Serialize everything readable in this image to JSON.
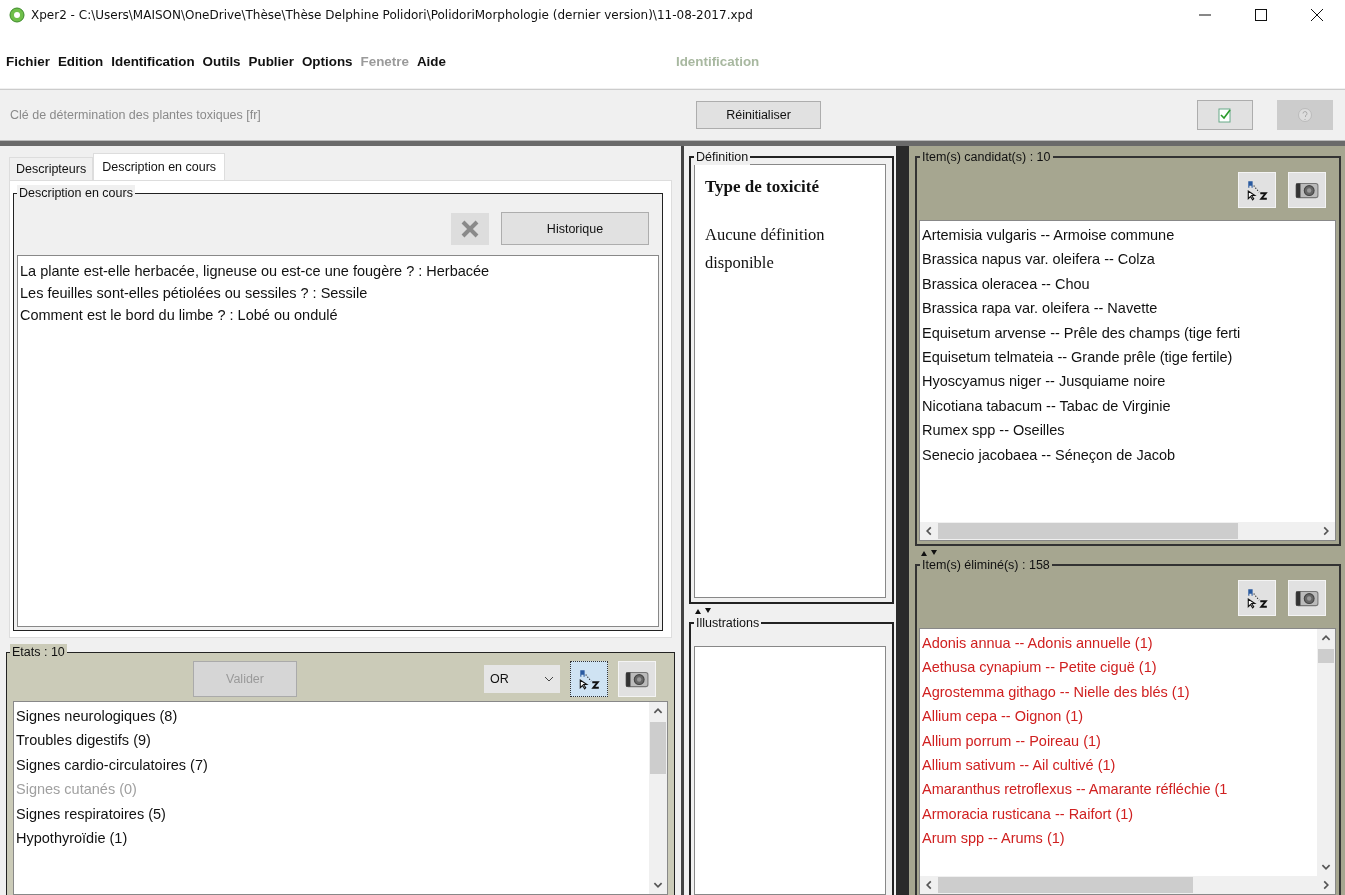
{
  "window": {
    "title": "Xper2 - C:\\Users\\MAISON\\OneDrive\\Thèse\\Thèse Delphine Polidori\\PolidoriMorphologie (dernier version)\\11-08-2017.xpd"
  },
  "menu": [
    {
      "label": "Fichier",
      "disabled": false
    },
    {
      "label": "Edition",
      "disabled": false
    },
    {
      "label": "Identification",
      "disabled": false
    },
    {
      "label": "Outils",
      "disabled": false
    },
    {
      "label": "Publier",
      "disabled": false
    },
    {
      "label": "Options",
      "disabled": false
    },
    {
      "label": "Fenetre",
      "disabled": true
    },
    {
      "label": "Aide",
      "disabled": false
    }
  ],
  "mode_label": "Identification",
  "toolbar": {
    "key_title": "Clé de détermination des plantes toxiques [fr]",
    "reset_button": "Réinitialiser"
  },
  "tabs": [
    {
      "label": "Descripteurs",
      "selected": false
    },
    {
      "label": "Description en cours",
      "selected": true
    }
  ],
  "description": {
    "title": "Description en cours",
    "history_button": "Historique",
    "lines": [
      "La plante est-elle herbacée, ligneuse ou est-ce une fougère ? : Herbacée",
      "Les feuilles sont-elles pétiolées ou sessiles ? : Sessile",
      "Comment est le bord du limbe ? : Lobé ou ondulé"
    ]
  },
  "states": {
    "title": "Etats : 10",
    "validate_button": {
      "label": "Valider",
      "disabled": true
    },
    "operator": "OR",
    "items": [
      {
        "label": "Signes neurologiques (8)",
        "disabled": false
      },
      {
        "label": "Troubles digestifs (9)",
        "disabled": false
      },
      {
        "label": "Signes cardio-circulatoires (7)",
        "disabled": false
      },
      {
        "label": "Signes cutanés (0)",
        "disabled": true
      },
      {
        "label": "Signes respiratoires (5)",
        "disabled": false
      },
      {
        "label": "Hypothyroïdie (1)",
        "disabled": false
      }
    ]
  },
  "definition": {
    "title": "Définition",
    "heading": "Type de toxicité",
    "text": "Aucune définition disponible"
  },
  "illustrations": {
    "title": "Illustrations"
  },
  "candidates": {
    "title": "Item(s) candidat(s) : 10",
    "items": [
      "Artemisia vulgaris -- Armoise commune",
      "Brassica napus var. oleifera -- Colza",
      "Brassica oleracea -- Chou",
      "Brassica rapa var. oleifera -- Navette",
      "Equisetum arvense -- Prêle des champs (tige ferti",
      "Equisetum telmateia -- Grande prêle (tige fertile)",
      "Hyoscyamus niger -- Jusquiame noire",
      "Nicotiana tabacum -- Tabac de Virginie",
      "Rumex spp -- Oseilles",
      "Senecio jacobaea -- Séneçon de Jacob"
    ]
  },
  "eliminated": {
    "title": "Item(s) éliminé(s) : 158",
    "items": [
      "Adonis annua -- Adonis annuelle (1)",
      "Aethusa cynapium -- Petite ciguë (1)",
      "Agrostemma githago -- Nielle des blés (1)",
      "Allium cepa -- Oignon (1)",
      "Allium porrum -- Poireau (1)",
      "Allium sativum -- Ail cultivé (1)",
      "Amaranthus retroflexus -- Amarante réfléchie (1",
      "Armoracia rusticana -- Raifort  (1)",
      "Arum spp -- Arums (1)"
    ]
  }
}
